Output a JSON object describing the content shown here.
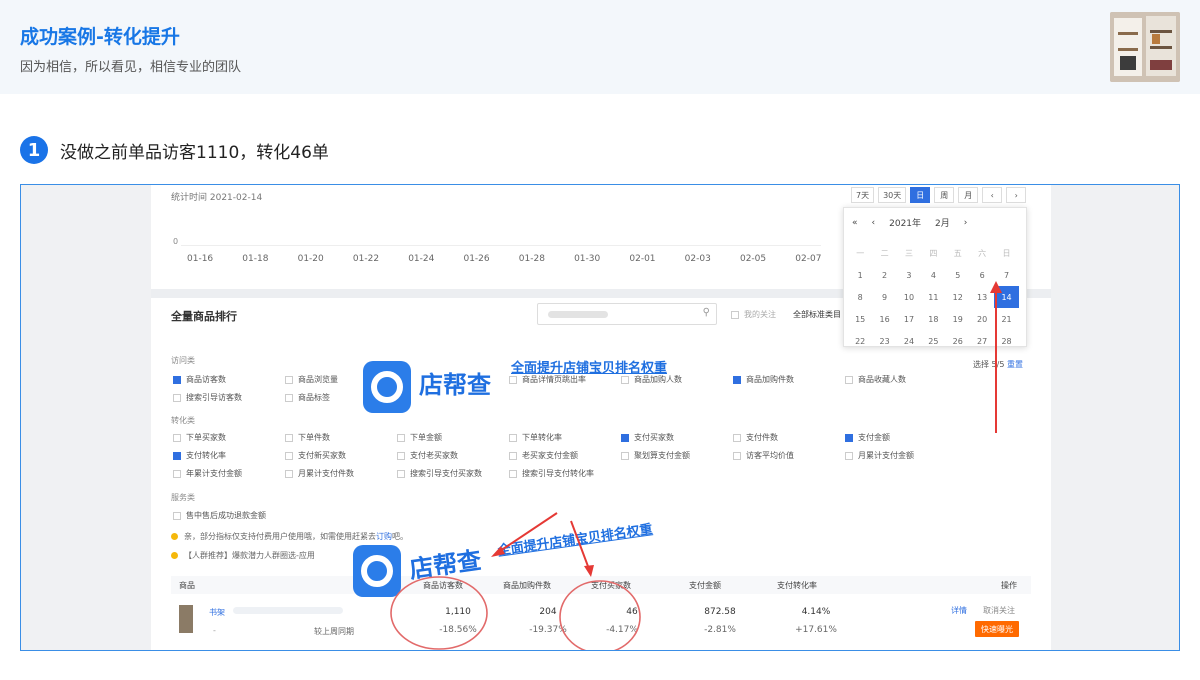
{
  "header": {
    "title": "成功案例-转化提升",
    "subtitle": "因为相信，所以看见，相信专业的团队"
  },
  "step": {
    "number": "1",
    "text": "没做之前单品访客1110，转化46单"
  },
  "shot": {
    "stat_date": "统计时间 2021-02-14",
    "period_buttons": [
      "7天",
      "30天",
      "日",
      "周",
      "月",
      "‹",
      "›"
    ],
    "active_period": "日",
    "chart_zero": "0",
    "x_ticks": [
      "01-16",
      "01-18",
      "01-20",
      "01-22",
      "01-24",
      "01-26",
      "01-28",
      "01-30",
      "02-01",
      "02-03",
      "02-05",
      "02-07"
    ],
    "calendar": {
      "nav_prev_year": "«",
      "nav_prev": "‹",
      "year": "2021年",
      "month": "2月",
      "nav_next": "›",
      "weekdays": [
        "一",
        "二",
        "三",
        "四",
        "五",
        "六",
        "日"
      ],
      "days": [
        "1",
        "2",
        "3",
        "4",
        "5",
        "6",
        "7",
        "8",
        "9",
        "10",
        "11",
        "12",
        "13",
        "14",
        "15",
        "16",
        "17",
        "18",
        "19",
        "20",
        "21",
        "22",
        "23",
        "24",
        "25",
        "26",
        "27",
        "28"
      ],
      "selected": "14"
    },
    "rank_title": "全量商品排行",
    "follow_only": "我的关注",
    "all_std": "全部标准类目",
    "groups": {
      "visit": "访问类",
      "convert": "转化类",
      "service": "服务类"
    },
    "visit_options": [
      {
        "label": "商品访客数",
        "checked": true
      },
      {
        "label": "商品浏览量",
        "checked": false
      },
      {
        "label": "商品详情页跳出率",
        "checked": false
      },
      {
        "label": "商品加购人数",
        "checked": false
      },
      {
        "label": "商品加购件数",
        "checked": true
      },
      {
        "label": "商品收藏人数",
        "checked": false
      },
      {
        "label": "搜索引导访客数",
        "checked": false
      },
      {
        "label": "商品标签",
        "checked": false
      }
    ],
    "convert_options": [
      {
        "label": "下单买家数",
        "checked": false
      },
      {
        "label": "下单件数",
        "checked": false
      },
      {
        "label": "下单金额",
        "checked": false
      },
      {
        "label": "下单转化率",
        "checked": false
      },
      {
        "label": "支付买家数",
        "checked": true
      },
      {
        "label": "支付件数",
        "checked": false
      },
      {
        "label": "支付金额",
        "checked": true
      },
      {
        "label": "支付转化率",
        "checked": true
      },
      {
        "label": "支付新买家数",
        "checked": false
      },
      {
        "label": "支付老买家数",
        "checked": false
      },
      {
        "label": "老买家支付金额",
        "checked": false
      },
      {
        "label": "聚划算支付金额",
        "checked": false
      },
      {
        "label": "访客平均价值",
        "checked": false
      },
      {
        "label": "月累计支付金额",
        "checked": false
      },
      {
        "label": "年累计支付金额",
        "checked": false
      },
      {
        "label": "月累计支付件数",
        "checked": false
      },
      {
        "label": "搜索引导支付买家数",
        "checked": false
      },
      {
        "label": "搜索引导支付转化率",
        "checked": false
      }
    ],
    "service_options": [
      {
        "label": "售中售后成功退款金额",
        "checked": false
      }
    ],
    "select_label": "选择",
    "select_count": "5/5",
    "reset": "重置",
    "notice1_pre": "亲，部分指标仅支持付费用户使用哦，如需使用赶紧去",
    "notice1_link": "订购",
    "notice1_post": "吧。",
    "notice2": "【人群推荐】爆款潜力人群圈选-应用",
    "table": {
      "headers": {
        "product": "商品",
        "visitors": "商品访客数",
        "addcart": "商品加购件数",
        "buyers": "支付买家数",
        "amount": "支付金额",
        "rate": "支付转化率",
        "action": "操作"
      },
      "row": {
        "name": "书架",
        "dash": "-",
        "compare": "较上周同期",
        "visitors": "1,110",
        "visitors_pct": "-18.56%",
        "addcart": "204",
        "addcart_pct": "-19.37%",
        "buyers": "46",
        "buyers_pct": "-4.17%",
        "amount": "872.58",
        "amount_pct": "-2.81%",
        "rate": "4.14%",
        "rate_pct": "+17.61%",
        "detail": "详情",
        "unfollow": "取消关注",
        "fast": "快速曝光"
      }
    }
  },
  "watermark": {
    "brand": "店帮查",
    "slogan": "全面提升店铺宝贝排名权重"
  },
  "colors": {
    "accent": "#1a73e8",
    "circle": "#e26a6a",
    "arrow": "#e53935",
    "fast_button": "#ff6a00"
  }
}
